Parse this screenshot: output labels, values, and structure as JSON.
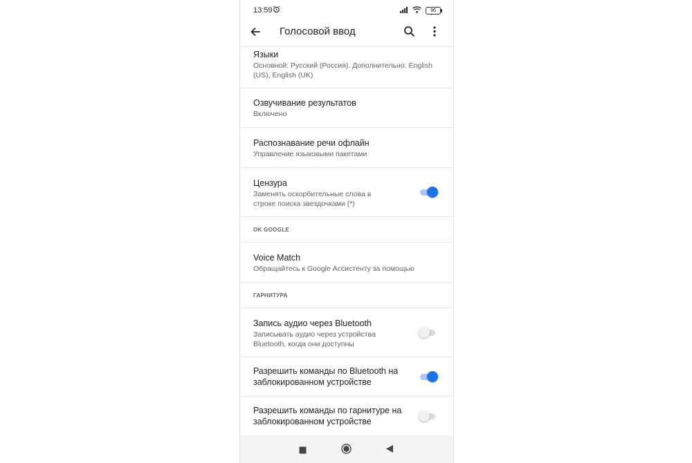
{
  "status_bar": {
    "time": "13:59",
    "battery": "96"
  },
  "app_bar": {
    "title": "Голосовой ввод"
  },
  "settings": {
    "languages": {
      "title": "Языки",
      "subtitle": "Основной: Русский (Россия). Дополнительно: English (US), English (UK)"
    },
    "speech_output": {
      "title": "Озвучивание результатов",
      "subtitle": "Включено"
    },
    "offline": {
      "title": "Распознавание речи офлайн",
      "subtitle": "Управление языковыми пакетами"
    },
    "censor": {
      "title": "Цензура",
      "subtitle": "Заменять оскорбительные слова в строке поиска звездочками (*)",
      "enabled": true
    }
  },
  "sections": {
    "ok_google": "OK GOOGLE",
    "headset": "ГАРНИТУРА"
  },
  "ok_google": {
    "voice_match": {
      "title": "Voice Match",
      "subtitle": "Обращайтесь к Google Ассистенту за помощью"
    }
  },
  "headset": {
    "bt_audio": {
      "title": "Запись аудио через Bluetooth",
      "subtitle": "Записывать аудио через устройства Bluetooth, когда они доступны",
      "enabled": false
    },
    "bt_locked": {
      "title": "Разрешить команды по Bluetooth на заблокированном устройстве",
      "enabled": true
    },
    "headset_locked": {
      "title": "Разрешить команды по гарнитуре на заблокированном устройстве",
      "enabled": false
    }
  },
  "colors": {
    "accent": "#1a73e8",
    "accent_track": "#a8c7fa",
    "divider": "#e6e6e6"
  }
}
